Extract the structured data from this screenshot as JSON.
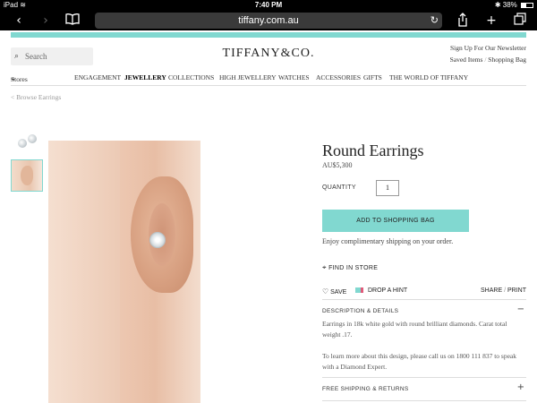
{
  "status_bar": {
    "device": "iPad",
    "wifi_icon": "wifi-icon",
    "time": "7:40 PM",
    "battery": "38%"
  },
  "toolbar": {
    "url": "tiffany.com.au"
  },
  "header": {
    "search_placeholder": "Search",
    "logo": "TIFFANY&CO.",
    "newsletter": "Sign Up For Our Newsletter",
    "saved_items": "Saved Items",
    "link_separator": "/",
    "shopping_bag": "Shopping Bag"
  },
  "nav": {
    "stores": "Stores",
    "items": [
      "ENGAGEMENT",
      "JEWELLERY",
      "COLLECTIONS",
      "HIGH JEWELLERY",
      "WATCHES",
      "ACCESSORIES",
      "GIFTS",
      "THE WORLD OF TIFFANY"
    ],
    "active": "JEWELLERY"
  },
  "breadcrumb": "< Browse Earrings",
  "product": {
    "title": "Round Earrings",
    "price": "AU$5,300",
    "quantity_label": "QUANTITY",
    "quantity": "1",
    "add_to_bag": "ADD TO SHOPPING BAG",
    "shipping_note": "Enjoy complimentary shipping on your order.",
    "find_in_store": "FIND IN STORE",
    "save": "SAVE",
    "drop_hint": "DROP A HINT",
    "share": "SHARE",
    "share_separator": "/",
    "print": "PRINT"
  },
  "accordion": {
    "description_title": "DESCRIPTION & DETAILS",
    "description_toggle": "−",
    "description_text": "Earrings in 18k white gold with round brilliant diamonds. Carat total weight .17.",
    "contact_text": "To learn more about this design, please call us on 1800 111 837 to speak with a Diamond Expert.",
    "shipping_title": "FREE SHIPPING & RETURNS",
    "shipping_toggle": "+"
  },
  "colors": {
    "tiffany_blue": "#81d8d0",
    "hint_pink": "#e05b7a"
  }
}
